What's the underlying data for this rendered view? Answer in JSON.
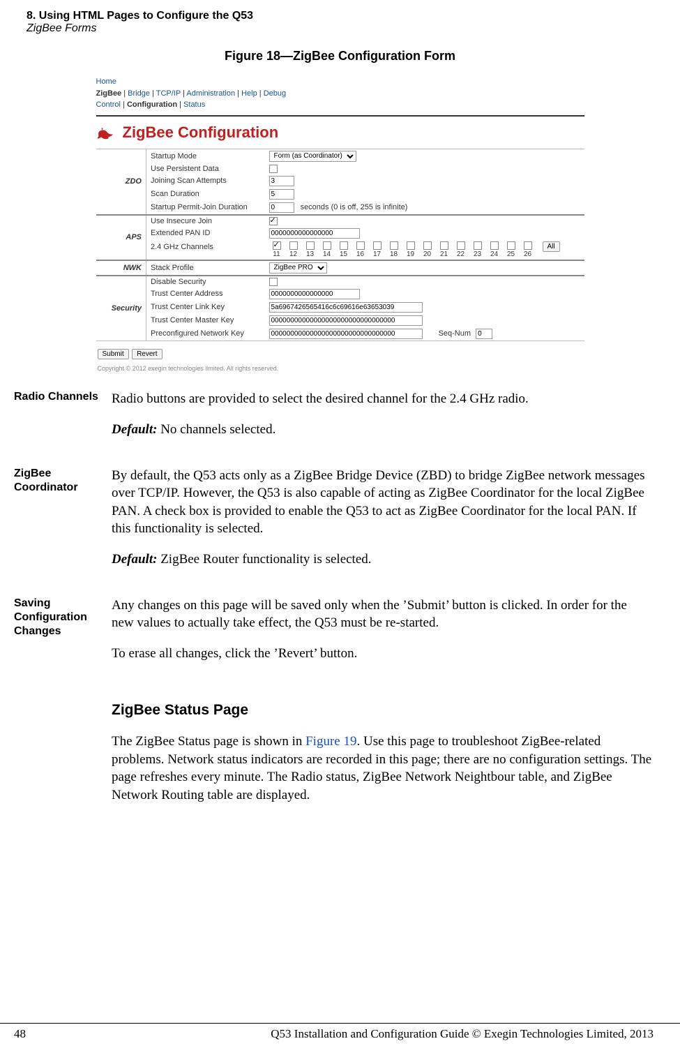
{
  "header": {
    "chapter": "8. Using HTML Pages to Configure the Q53",
    "section": "ZigBee Forms"
  },
  "figure": {
    "caption": "Figure 18—ZigBee Configuration Form"
  },
  "form": {
    "crumbs": {
      "home": "Home",
      "line2_parts": [
        "ZigBee",
        "Bridge",
        "TCP/IP",
        "Administration",
        "Help",
        "Debug"
      ],
      "line3_parts": [
        "Control",
        "Configuration",
        "Status"
      ]
    },
    "title": "ZigBee Configuration",
    "zdo": {
      "label": "ZDO",
      "startup_mode_lbl": "Startup Mode",
      "startup_mode_val": "Form (as Coordinator)",
      "use_persist_lbl": "Use Persistent Data",
      "use_persist_checked": false,
      "joining_scan_lbl": "Joining Scan Attempts",
      "joining_scan_val": "3",
      "scan_dur_lbl": "Scan Duration",
      "scan_dur_val": "5",
      "permit_join_lbl": "Startup Permit-Join Duration",
      "permit_join_val": "0",
      "permit_join_hint": "seconds (0 is off, 255 is infinite)"
    },
    "aps": {
      "label": "APS",
      "insecure_lbl": "Use Insecure Join",
      "insecure_checked": true,
      "epanid_lbl": "Extended PAN ID",
      "epanid_val": "0000000000000000",
      "channels_lbl": "2.4 GHz Channels",
      "channels": [
        "11",
        "12",
        "13",
        "14",
        "15",
        "16",
        "17",
        "18",
        "19",
        "20",
        "21",
        "22",
        "23",
        "24",
        "25",
        "26"
      ],
      "all_btn": "All"
    },
    "nwk": {
      "label": "NWK",
      "stack_lbl": "Stack Profile",
      "stack_val": "ZigBee PRO"
    },
    "sec": {
      "label": "Security",
      "disable_lbl": "Disable Security",
      "disable_checked": false,
      "tc_addr_lbl": "Trust Center Address",
      "tc_addr_val": "0000000000000000",
      "tc_link_lbl": "Trust Center Link Key",
      "tc_link_val": "5a6967426565416c6c69616e63653039",
      "tc_master_lbl": "Trust Center Master Key",
      "tc_master_val": "00000000000000000000000000000000",
      "preconf_lbl": "Preconfigured Network Key",
      "preconf_val": "00000000000000000000000000000000",
      "seqnum_lbl": "Seq-Num",
      "seqnum_val": "0"
    },
    "buttons": {
      "submit": "Submit",
      "revert": "Revert"
    },
    "copyright": "Copyright © 2012 exegin technologies limited. All rights reserved."
  },
  "body": {
    "radio": {
      "label": "Radio Channels",
      "p1": "Radio buttons are provided to select the desired channel for the 2.4 GHz radio.",
      "default_lbl": "Default:",
      "default_val": " No channels selected."
    },
    "coord": {
      "label": "ZigBee Coordinator",
      "p1": "By default, the Q53 acts only as a ZigBee Bridge Device (ZBD) to bridge ZigBee network messages over TCP/IP. However, the Q53 is also capable of acting as ZigBee Coordinator for the local ZigBee PAN. A check box is provided to enable the Q53 to act as ZigBee Coordinator for the local PAN. If this functionality is selected.",
      "default_lbl": "Default:",
      "default_val": " ZigBee Router functionality is selected."
    },
    "saving": {
      "label": "Saving Configuration Changes",
      "p1": "Any changes on this page will be saved only when the ’Submit’ button is clicked. In order for the new values to actually take effect, the Q53 must be re-started.",
      "p2": "To erase all changes, click the ’Revert’ button."
    },
    "status": {
      "heading": "ZigBee Status Page",
      "pre": "The ZigBee Status page is shown in ",
      "xref": "Figure 19",
      "post": ". Use this page to troubleshoot ZigBee-related problems. Network status indicators are recorded in this page; there are no configuration settings. The page refreshes every minute. The Radio status, ZigBee Network Neightbour table, and ZigBee Network Routing table are displayed."
    }
  },
  "footer": {
    "pageno": "48",
    "text": "Q53 Installation and Configuration Guide  © Exegin Technologies Limited, 2013"
  }
}
